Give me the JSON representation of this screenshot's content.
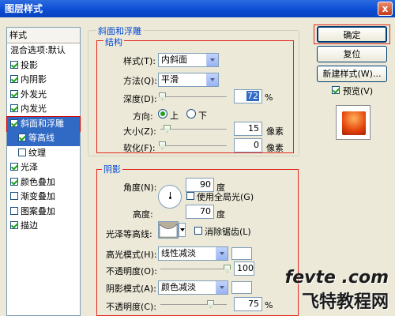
{
  "window": {
    "title": "图层样式",
    "close_label": "x"
  },
  "sidebar": {
    "header": "样式",
    "items": [
      {
        "label": "混合选项:默认",
        "checkbox": false
      },
      {
        "label": "投影",
        "checkbox": true,
        "checked": true
      },
      {
        "label": "内阴影",
        "checkbox": true,
        "checked": true
      },
      {
        "label": "外发光",
        "checkbox": true,
        "checked": true
      },
      {
        "label": "内发光",
        "checkbox": true,
        "checked": true
      },
      {
        "label": "斜面和浮雕",
        "checkbox": true,
        "checked": true,
        "selected": true
      },
      {
        "label": "等高线",
        "checkbox": true,
        "checked": true,
        "sub": true,
        "highlighted": true
      },
      {
        "label": "纹理",
        "checkbox": true,
        "checked": false,
        "sub": true
      },
      {
        "label": "光泽",
        "checkbox": true,
        "checked": true
      },
      {
        "label": "颜色叠加",
        "checkbox": true,
        "checked": true
      },
      {
        "label": "渐变叠加",
        "checkbox": true,
        "checked": false
      },
      {
        "label": "图案叠加",
        "checkbox": true,
        "checked": false
      },
      {
        "label": "描边",
        "checkbox": true,
        "checked": true
      }
    ]
  },
  "bevel": {
    "group_title": "斜面和浮雕",
    "struct_title": "结构",
    "style_label": "样式(T):",
    "style_value": "内斜面",
    "method_label": "方法(Q):",
    "method_value": "平滑",
    "depth_label": "深度(D):",
    "depth_value": "72",
    "depth_unit": "%",
    "direction_label": "方向:",
    "dir_up": "上",
    "dir_down": "下",
    "size_label": "大小(Z):",
    "size_value": "15",
    "size_unit": "像素",
    "soften_label": "软化(F):",
    "soften_value": "0",
    "soften_unit": "像素"
  },
  "shading": {
    "group_title": "阴影",
    "angle_label": "角度(N):",
    "angle_value": "90",
    "angle_unit": "度",
    "global_light_label": "使用全局光(G)",
    "altitude_label": "高度:",
    "altitude_value": "70",
    "altitude_unit": "度",
    "gloss_contour_label": "光泽等高线:",
    "antialias_label": "消除锯齿(L)",
    "highlight_mode_label": "高光模式(H):",
    "highlight_mode_value": "线性减淡",
    "highlight_color": "#ffffff",
    "opacity1_label": "不透明度(O):",
    "opacity1_value": "100",
    "shadow_mode_label": "阴影模式(A):",
    "shadow_mode_value": "颜色减淡",
    "shadow_color": "#ffffff",
    "opacity2_label": "不透明度(C):",
    "opacity2_value": "75",
    "opacity_unit": "%"
  },
  "buttons": {
    "ok": "确定",
    "reset": "复位",
    "new_style": "新建样式(W)...",
    "preview_label": "预览(V)"
  },
  "watermark": {
    "line1": "fevte .com",
    "line2": "飞特教程网"
  }
}
